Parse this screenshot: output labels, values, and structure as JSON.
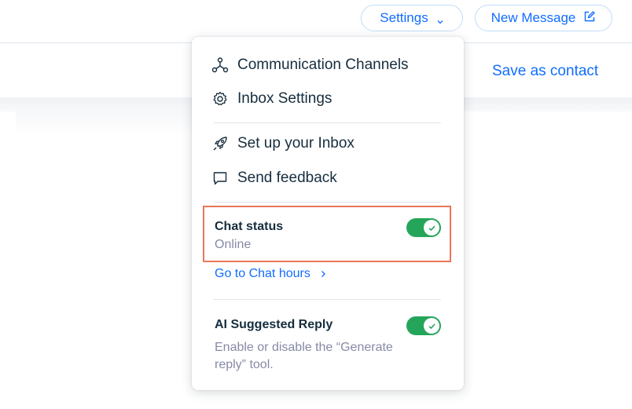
{
  "header": {
    "settings_label": "Settings",
    "new_message_label": "New Message"
  },
  "contact": {
    "save_label": "Save as contact"
  },
  "settings_menu": {
    "items": [
      {
        "label": "Communication Channels",
        "icon": "channels-icon"
      },
      {
        "label": "Inbox Settings",
        "icon": "gear-icon"
      },
      {
        "label": "Set up your Inbox",
        "icon": "rocket-icon"
      },
      {
        "label": "Send feedback",
        "icon": "chat-bubble-icon"
      }
    ],
    "chat_status": {
      "title": "Chat status",
      "value": "Online",
      "enabled": true,
      "link_label": "Go to Chat hours"
    },
    "ai_reply": {
      "title": "AI Suggested Reply",
      "description": "Enable or disable the “Generate reply” tool.",
      "enabled": true
    }
  },
  "colors": {
    "accent": "#116dff",
    "toggle_on": "#25a55a",
    "highlight": "#e8765a"
  }
}
